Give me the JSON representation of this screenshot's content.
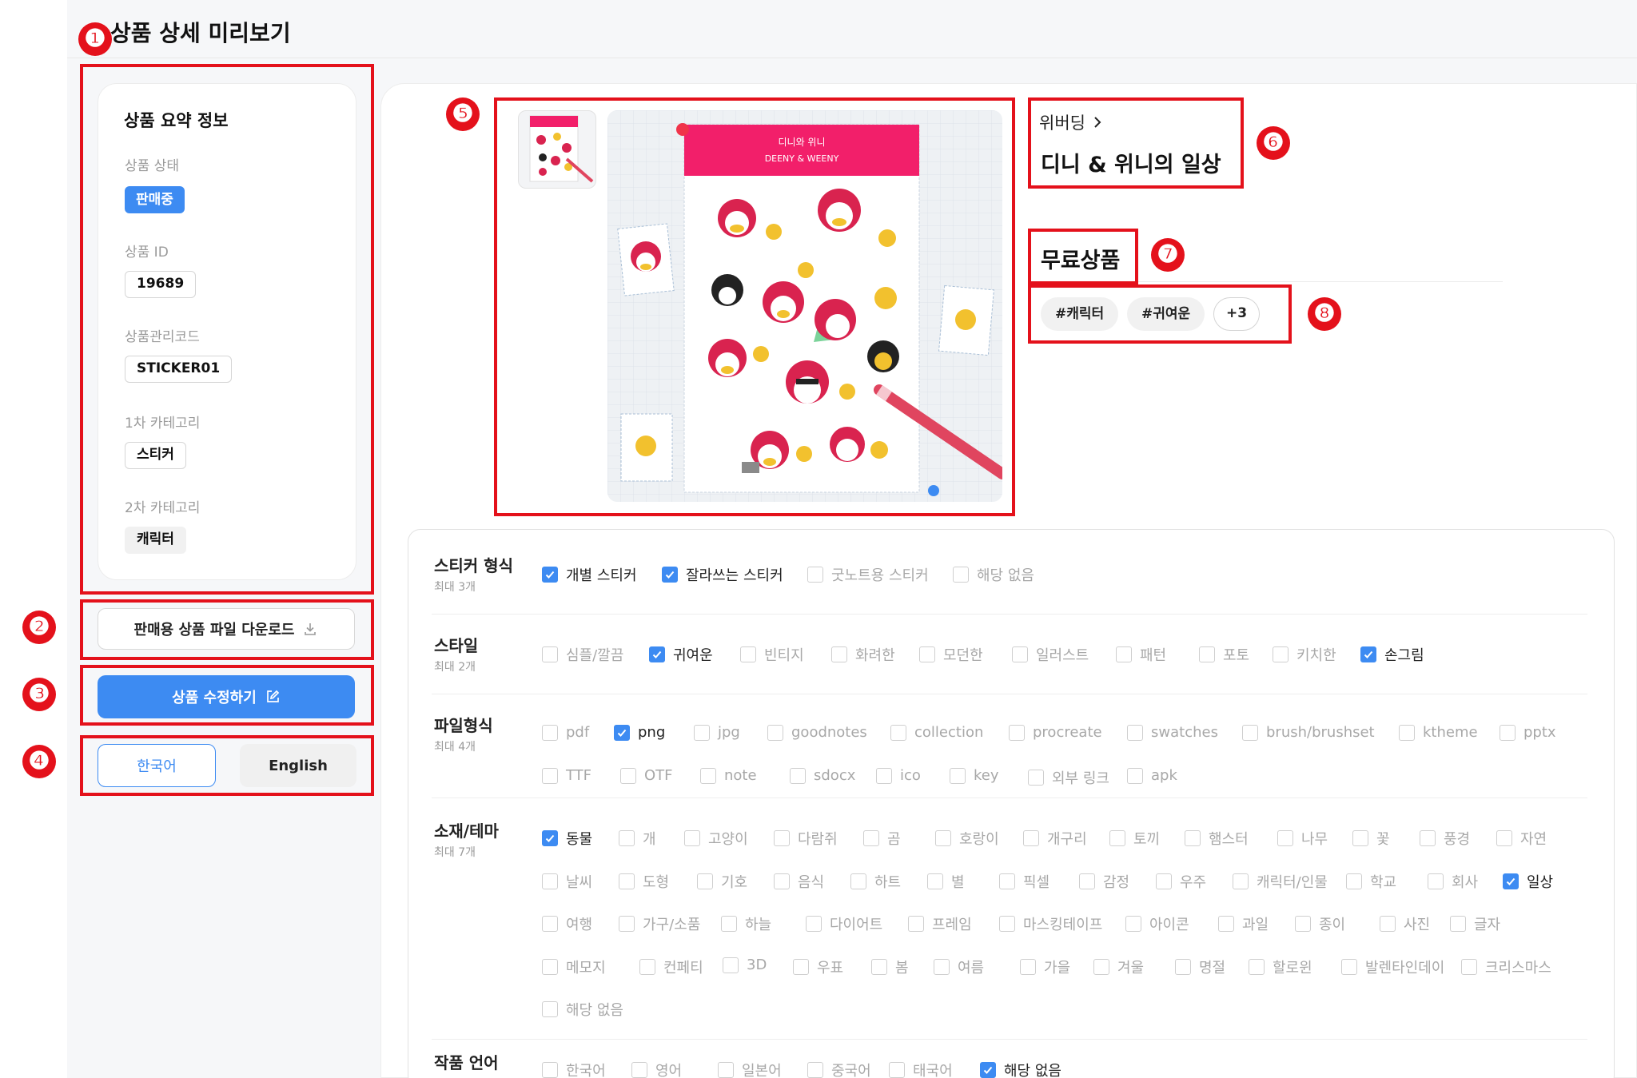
{
  "page": {
    "title": "상품 상세 미리보기"
  },
  "markers": [
    "❶",
    "❷",
    "❸",
    "❹",
    "❺",
    "❻",
    "❼",
    "❽"
  ],
  "summary": {
    "title": "상품 요약 정보",
    "status_label": "상품 상태",
    "status_value": "판매중",
    "id_label": "상품 ID",
    "id_value": "19689",
    "code_label": "상품관리코드",
    "code_value": "STICKER01",
    "cat1_label": "1차 카테고리",
    "cat1_value": "스티커",
    "cat2_label": "2차 카테고리",
    "cat2_value": "캐릭터"
  },
  "actions": {
    "download_label": "판매용 상품 파일 다운로드",
    "edit_label": "상품 수정하기",
    "lang_korean": "한국어",
    "lang_english": "English"
  },
  "product": {
    "brand": "위버딩",
    "name": "디니 & 위니의 일상",
    "price": "무료상품",
    "tags": [
      "#캐릭터",
      "#귀여운"
    ],
    "more_tags": "+3",
    "sheet_title_kr": "디니와 위니",
    "sheet_title_en": "DEENY & WEENY"
  },
  "colors": {
    "accent": "#3d8bf2",
    "annotation": "#e4111b",
    "sheet_header": "#f21f6a"
  },
  "options": {
    "sticker_format": {
      "title": "스티커 형식",
      "limit": "최대 3개",
      "items": [
        {
          "label": "개별 스티커",
          "checked": true
        },
        {
          "label": "잘라쓰는 스티커",
          "checked": true
        },
        {
          "label": "굿노트용 스티커",
          "checked": false
        },
        {
          "label": "해당 없음",
          "checked": false
        }
      ]
    },
    "style": {
      "title": "스타일",
      "limit": "최대 2개",
      "items": [
        {
          "label": "심플/깔끔",
          "checked": false
        },
        {
          "label": "귀여운",
          "checked": true
        },
        {
          "label": "빈티지",
          "checked": false
        },
        {
          "label": "화려한",
          "checked": false
        },
        {
          "label": "모던한",
          "checked": false
        },
        {
          "label": "일러스트",
          "checked": false
        },
        {
          "label": "패턴",
          "checked": false
        },
        {
          "label": "포토",
          "checked": false
        },
        {
          "label": "키치한",
          "checked": false
        },
        {
          "label": "손그림",
          "checked": true
        }
      ]
    },
    "file_format": {
      "title": "파일형식",
      "limit": "최대 4개",
      "items": [
        {
          "label": "pdf",
          "checked": false
        },
        {
          "label": "png",
          "checked": true
        },
        {
          "label": "jpg",
          "checked": false
        },
        {
          "label": "goodnotes",
          "checked": false
        },
        {
          "label": "collection",
          "checked": false
        },
        {
          "label": "procreate",
          "checked": false
        },
        {
          "label": "swatches",
          "checked": false
        },
        {
          "label": "brush/brushset",
          "checked": false
        },
        {
          "label": "ktheme",
          "checked": false
        },
        {
          "label": "pptx",
          "checked": false
        },
        {
          "label": "TTF",
          "checked": false
        },
        {
          "label": "OTF",
          "checked": false
        },
        {
          "label": "note",
          "checked": false
        },
        {
          "label": "sdocx",
          "checked": false
        },
        {
          "label": "ico",
          "checked": false
        },
        {
          "label": "key",
          "checked": false
        },
        {
          "label": "외부 링크",
          "checked": false
        },
        {
          "label": "apk",
          "checked": false
        }
      ]
    },
    "theme": {
      "title": "소재/테마",
      "limit": "최대 7개",
      "items": [
        {
          "label": "동물",
          "checked": true
        },
        {
          "label": "개",
          "checked": false
        },
        {
          "label": "고양이",
          "checked": false
        },
        {
          "label": "다람쥐",
          "checked": false
        },
        {
          "label": "곰",
          "checked": false
        },
        {
          "label": "호랑이",
          "checked": false
        },
        {
          "label": "개구리",
          "checked": false
        },
        {
          "label": "토끼",
          "checked": false
        },
        {
          "label": "햄스터",
          "checked": false
        },
        {
          "label": "나무",
          "checked": false
        },
        {
          "label": "꽃",
          "checked": false
        },
        {
          "label": "풍경",
          "checked": false
        },
        {
          "label": "자연",
          "checked": false
        },
        {
          "label": "날씨",
          "checked": false
        },
        {
          "label": "도형",
          "checked": false
        },
        {
          "label": "기호",
          "checked": false
        },
        {
          "label": "음식",
          "checked": false
        },
        {
          "label": "하트",
          "checked": false
        },
        {
          "label": "별",
          "checked": false
        },
        {
          "label": "픽셀",
          "checked": false
        },
        {
          "label": "감정",
          "checked": false
        },
        {
          "label": "우주",
          "checked": false
        },
        {
          "label": "캐릭터/인물",
          "checked": false
        },
        {
          "label": "학교",
          "checked": false
        },
        {
          "label": "회사",
          "checked": false
        },
        {
          "label": "일상",
          "checked": true
        },
        {
          "label": "여행",
          "checked": false
        },
        {
          "label": "가구/소품",
          "checked": false
        },
        {
          "label": "하늘",
          "checked": false
        },
        {
          "label": "다이어트",
          "checked": false
        },
        {
          "label": "프레임",
          "checked": false
        },
        {
          "label": "마스킹테이프",
          "checked": false
        },
        {
          "label": "아이콘",
          "checked": false
        },
        {
          "label": "과일",
          "checked": false
        },
        {
          "label": "종이",
          "checked": false
        },
        {
          "label": "사진",
          "checked": false
        },
        {
          "label": "글자",
          "checked": false
        },
        {
          "label": "메모지",
          "checked": false
        },
        {
          "label": "컨페티",
          "checked": false
        },
        {
          "label": "3D",
          "checked": false
        },
        {
          "label": "우표",
          "checked": false
        },
        {
          "label": "봄",
          "checked": false
        },
        {
          "label": "여름",
          "checked": false
        },
        {
          "label": "가을",
          "checked": false
        },
        {
          "label": "겨울",
          "checked": false
        },
        {
          "label": "명절",
          "checked": false
        },
        {
          "label": "할로윈",
          "checked": false
        },
        {
          "label": "발렌타인데이",
          "checked": false
        },
        {
          "label": "크리스마스",
          "checked": false
        },
        {
          "label": "해당 없음",
          "checked": false
        }
      ]
    },
    "language": {
      "title": "작품 언어",
      "items": [
        {
          "label": "한국어",
          "checked": false
        },
        {
          "label": "영어",
          "checked": false
        },
        {
          "label": "일본어",
          "checked": false
        },
        {
          "label": "중국어",
          "checked": false
        },
        {
          "label": "태국어",
          "checked": false
        },
        {
          "label": "해당 없음",
          "checked": true
        }
      ]
    }
  }
}
